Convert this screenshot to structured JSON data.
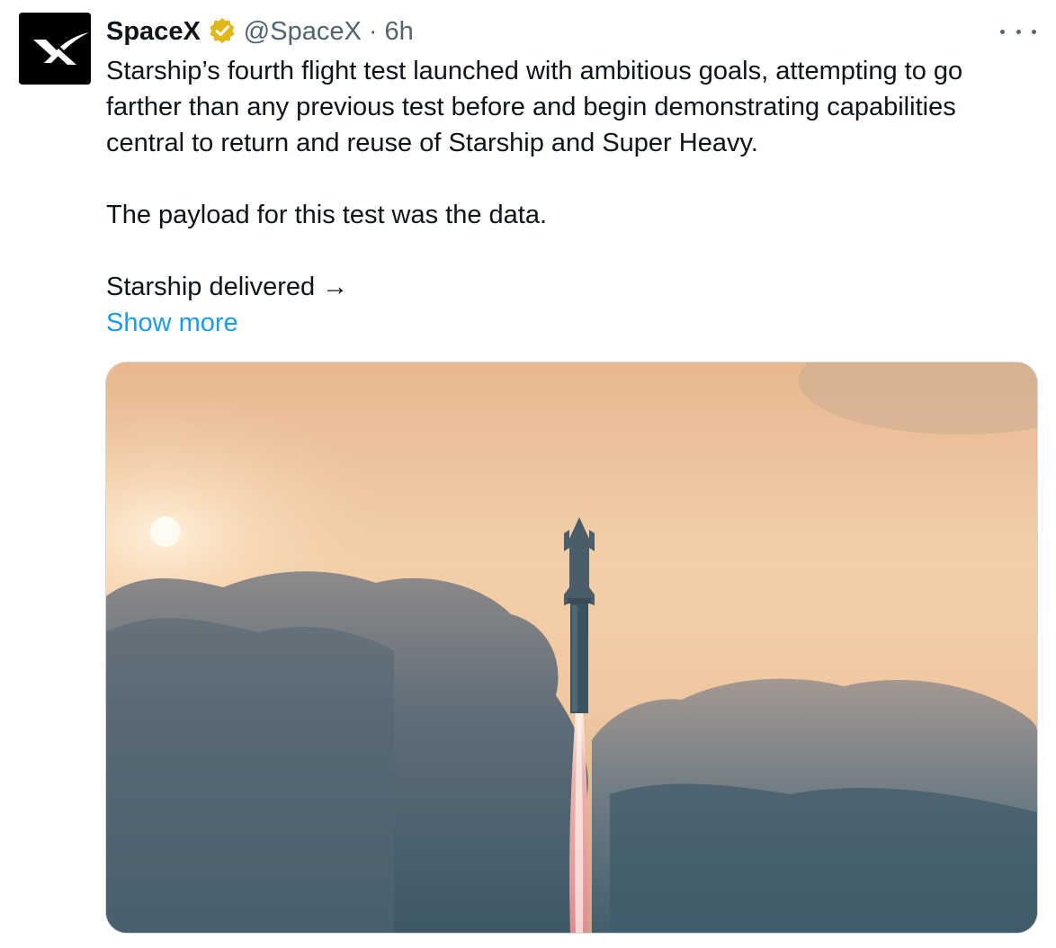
{
  "tweet": {
    "display_name": "SpaceX",
    "handle": "@SpaceX",
    "separator": "·",
    "time": "6h",
    "body_lines_1": [
      "Starship’s fourth flight test launched with ambitious goals, attempting to go",
      "farther than any previous test before and begin demonstrating capabilities",
      "central to return and reuse of Starship and Super Heavy."
    ],
    "body_line_2": "The payload for this test was the data.",
    "body_line_3": "Starship delivered →",
    "show_more": "Show more"
  },
  "icons": {
    "avatar": "spacex-x-logo",
    "verified": "verified-badge-icon",
    "more": "more-options-icon"
  },
  "colors": {
    "link": "#1d9bf0",
    "secondary_text": "#536471",
    "primary_text": "#0f1419",
    "verified_badge": "#e2b719",
    "media_border": "#cfd9de"
  }
}
